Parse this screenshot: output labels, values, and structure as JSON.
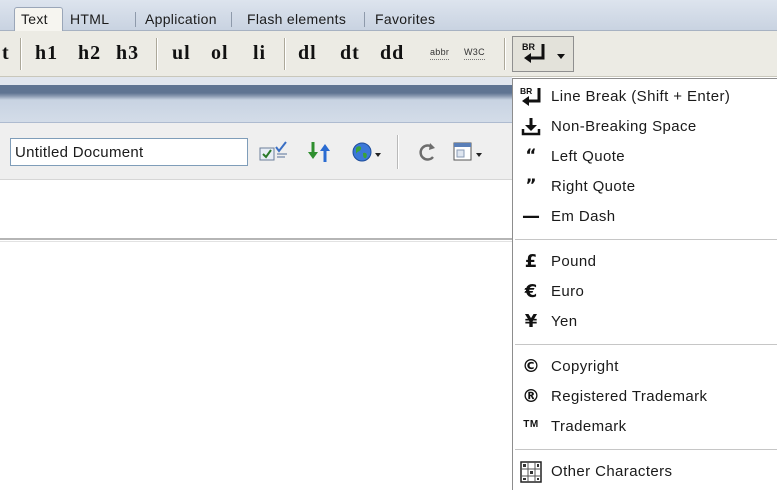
{
  "colors": {
    "tab_bar_top": "#dde4ee",
    "tab_bar_bottom": "#c9d3e1",
    "toolbar_bg": "#ecebe4",
    "title_bar_dark": "#5f7492",
    "title_bar_light": "#c8d3e2",
    "menu_bg": "#ffffff",
    "menu_separator": "#c6c6c6"
  },
  "tabs": [
    {
      "label": "Text",
      "active": true
    },
    {
      "label": "HTML",
      "active": false
    },
    {
      "label": "Application",
      "active": false
    },
    {
      "label": "Flash elements",
      "active": false
    },
    {
      "label": "Favorites",
      "active": false
    }
  ],
  "insert_toolbar": {
    "partial_label": "t",
    "buttons": [
      "h1",
      "h2",
      "h3",
      "ul",
      "ol",
      "li",
      "dl",
      "dt",
      "dd"
    ],
    "small_buttons": [
      "abbr",
      "W3C"
    ],
    "characters_button": {
      "icon": "line-break-icon",
      "icon_text": "BR",
      "dropdown_icon": "chevron-down-icon",
      "pressed": true
    }
  },
  "document_window": {
    "title_field_value": "Untitled Document",
    "toolbar_icons": [
      "validate-markup-icon",
      "file-management-icon",
      "preview-in-browser-icon",
      "refresh-icon",
      "view-options-icon"
    ]
  },
  "characters_menu": {
    "groups": [
      {
        "items": [
          {
            "label": "Line Break (Shift + Enter)",
            "icon": "line-break-icon",
            "glyph": "BR"
          },
          {
            "label": "Non-Breaking Space",
            "icon": "non-breaking-space-icon"
          },
          {
            "label": "Left Quote",
            "icon": "left-quote-icon",
            "glyph": "“"
          },
          {
            "label": "Right Quote",
            "icon": "right-quote-icon",
            "glyph": "”"
          },
          {
            "label": "Em Dash",
            "icon": "em-dash-icon",
            "glyph": "—"
          }
        ]
      },
      {
        "items": [
          {
            "label": "Pound",
            "icon": "pound-icon",
            "glyph": "£"
          },
          {
            "label": "Euro",
            "icon": "euro-icon",
            "glyph": "€"
          },
          {
            "label": "Yen",
            "icon": "yen-icon",
            "glyph": "¥"
          }
        ]
      },
      {
        "items": [
          {
            "label": "Copyright",
            "icon": "copyright-icon",
            "glyph": "©"
          },
          {
            "label": "Registered Trademark",
            "icon": "registered-trademark-icon",
            "glyph": "®"
          },
          {
            "label": "Trademark",
            "icon": "trademark-icon",
            "glyph": "TM"
          }
        ]
      },
      {
        "items": [
          {
            "label": "Other Characters",
            "icon": "other-characters-icon"
          }
        ]
      }
    ]
  }
}
